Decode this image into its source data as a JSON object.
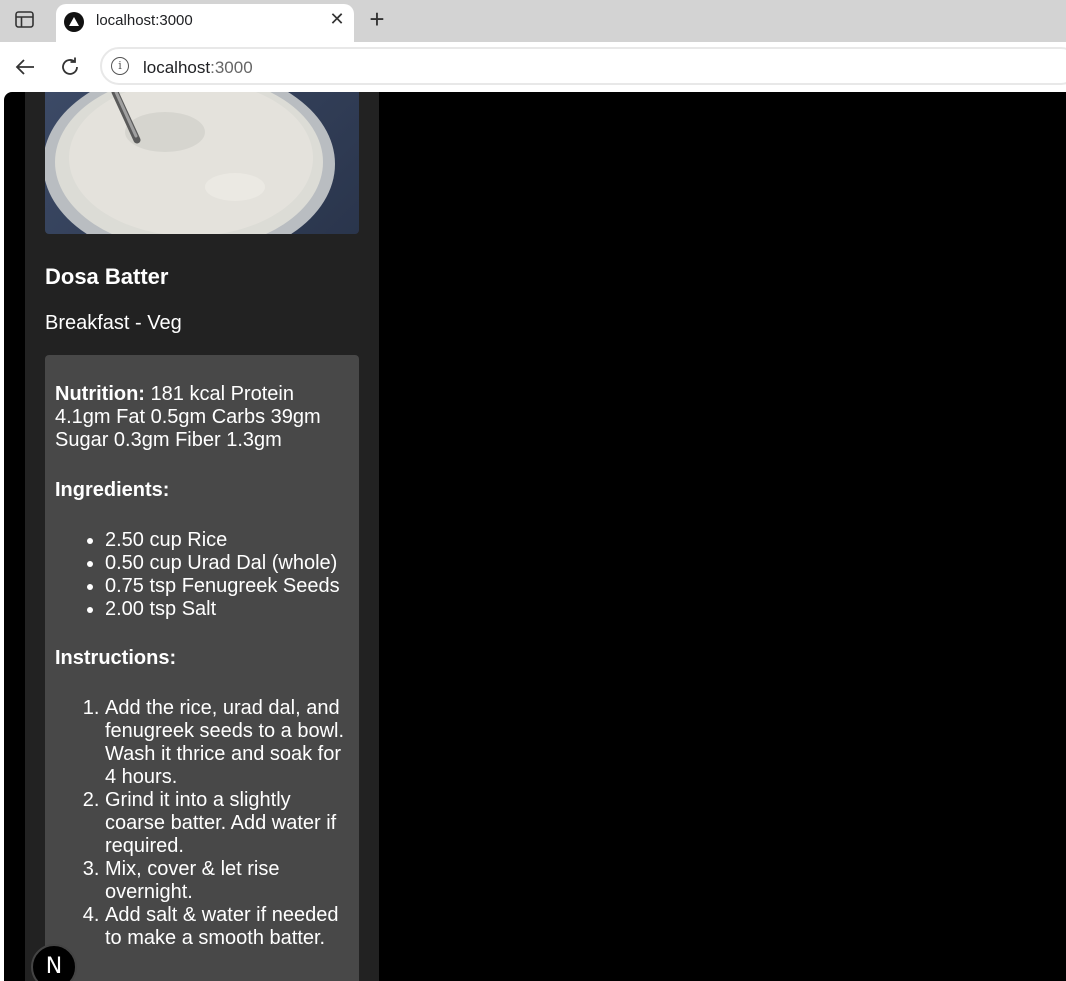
{
  "browser": {
    "tab_title": "localhost:3000",
    "url_host": "localhost",
    "url_port": ":3000"
  },
  "recipe": {
    "title": "Dosa Batter",
    "category": "Breakfast - Veg",
    "nutrition_label": "Nutrition:",
    "nutrition_text": " 181 kcal Protein 4.1gm Fat 0.5gm Carbs 39gm Sugar 0.3gm Fiber 1.3gm",
    "ingredients_label": "Ingredients:",
    "ingredients": [
      "2.50 cup Rice",
      "0.50 cup Urad Dal (whole)",
      "0.75 tsp Fenugreek Seeds",
      "2.00 tsp Salt"
    ],
    "instructions_label": "Instructions:",
    "instructions": [
      "Add the rice, urad dal, and fenugreek seeds to a bowl. Wash it thrice and soak for 4 hours.",
      "Grind it into a slightly coarse batter. Add water if required.",
      "Mix, cover & let rise overnight.",
      "Add salt & water if needed to make a smooth batter."
    ]
  },
  "dev_badge": "N"
}
